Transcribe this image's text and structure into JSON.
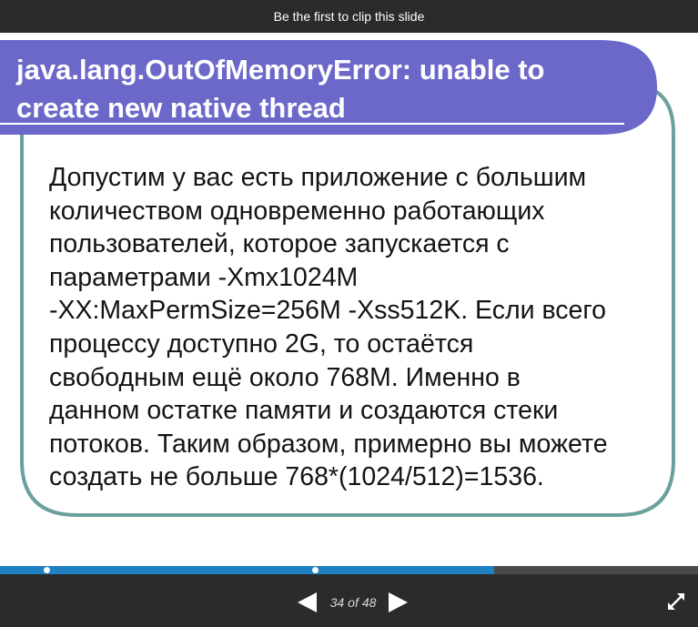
{
  "topbar": {
    "clip_text": "Be the first to clip this slide"
  },
  "slide": {
    "title_lines": [
      "java.lang.OutOfMemoryError: unable to",
      "create new native thread"
    ],
    "body_lines": [
      "Допустим у вас есть приложение с большим",
      "количеством одновременно работающих",
      "пользователей, которое запускается с",
      "параметрами -Xmx1024M",
      "-XX:MaxPermSize=256M -Xss512K. Если всего",
      "процессу доступно 2G, то остаётся",
      "свободным ещё около 768M. Именно в",
      "данном остатке памяти и создаются стеки",
      "потоков. Таким образом, примерно вы можете",
      "создать не больше 768*(1024/512)=1536."
    ],
    "colors": {
      "title_banner": "#6b68c9",
      "frame_border": "#6aa09d",
      "text": "#141414"
    }
  },
  "progress": {
    "fraction": 0.7083,
    "colors": {
      "fill": "#1f80c2",
      "track": "#4a4a4a"
    }
  },
  "player": {
    "current_page": "34",
    "of_label": "of",
    "total_pages": "48",
    "icons": {
      "prev": "triangle-left-icon",
      "next": "triangle-right-icon",
      "fullscreen": "expand-arrows-icon"
    }
  }
}
